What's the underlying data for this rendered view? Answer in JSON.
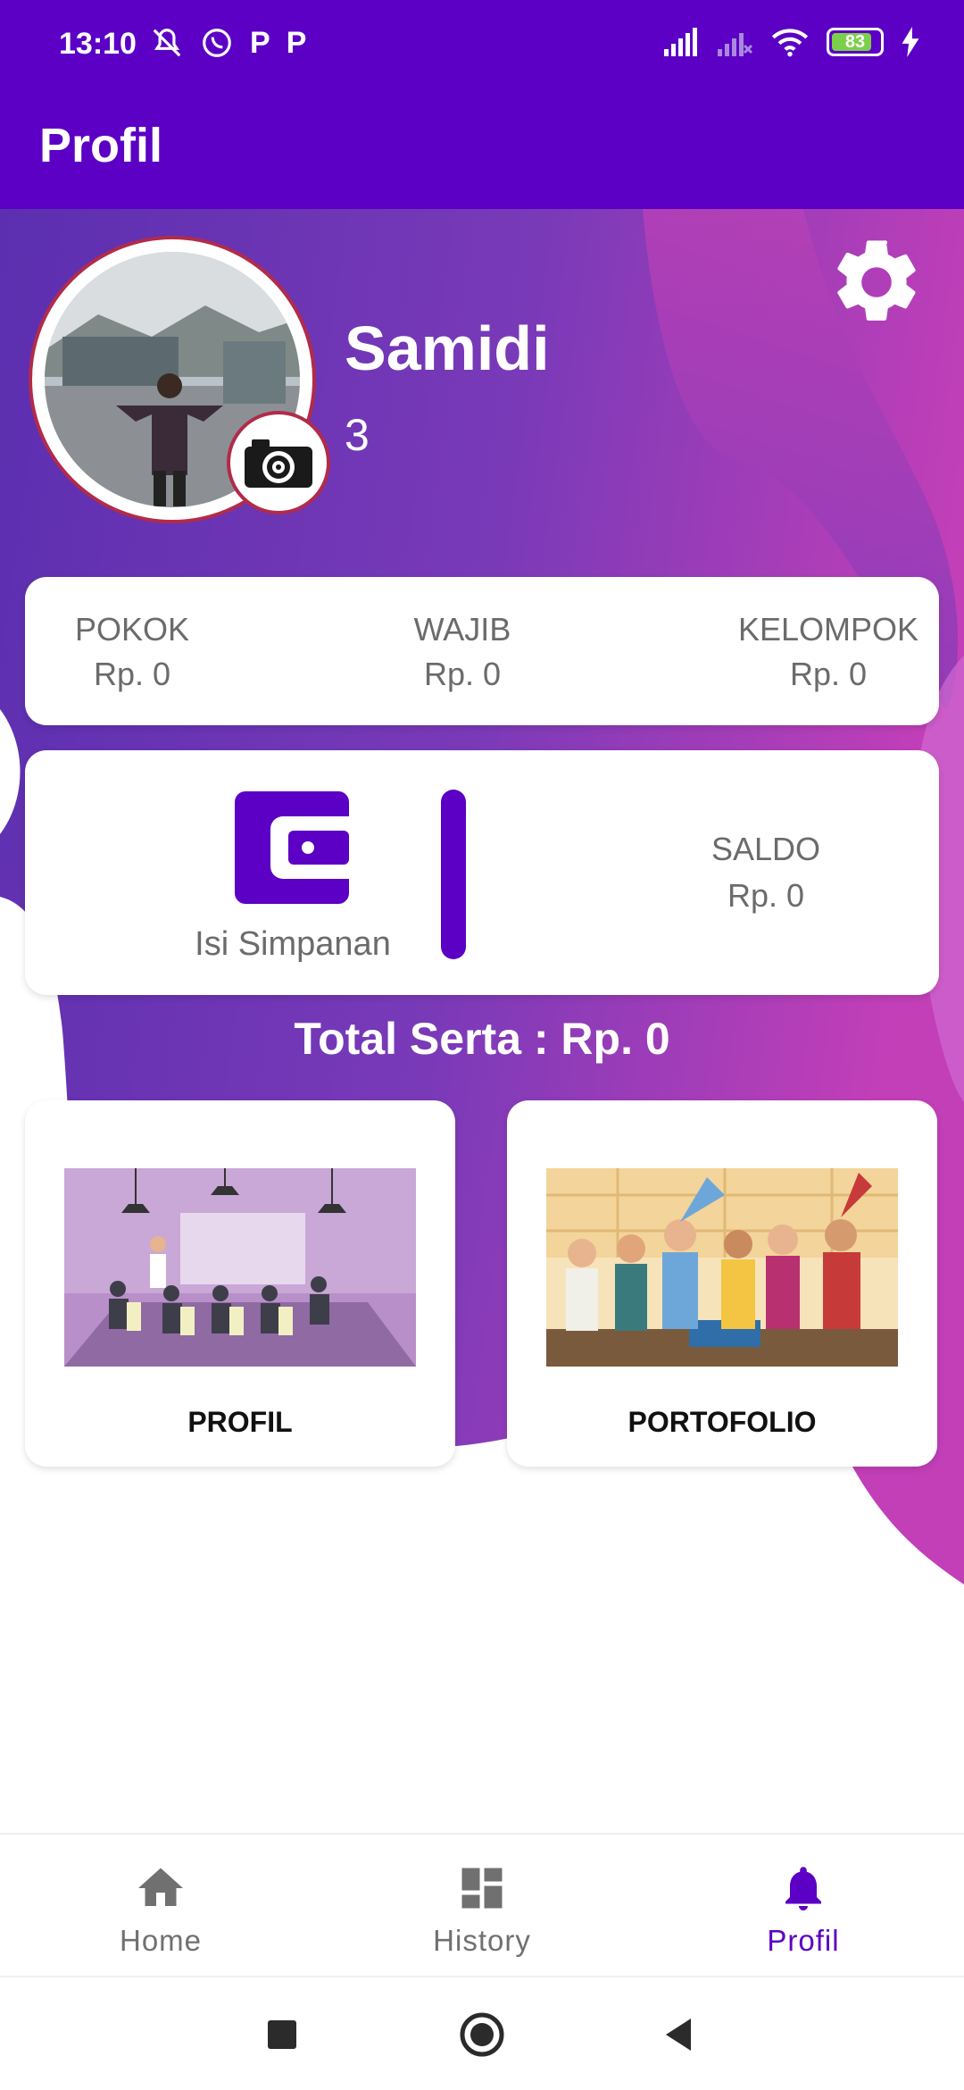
{
  "status_bar": {
    "time": "13:10",
    "left_glyphs": [
      "P",
      "P"
    ],
    "battery": "83",
    "icons": [
      "mute-icon",
      "whatsapp-icon",
      "p-app-icon",
      "p-app-icon",
      "signal-icon",
      "signal-off-icon",
      "wifi-icon",
      "battery-icon",
      "charging-icon"
    ]
  },
  "app_bar": {
    "title": "Profil"
  },
  "profile": {
    "name": "Samidi",
    "number": "3"
  },
  "savings": [
    {
      "label": "POKOK",
      "value": "Rp. 0"
    },
    {
      "label": "WAJIB",
      "value": "Rp. 0"
    },
    {
      "label": "KELOMPOK",
      "value": "Rp. 0"
    }
  ],
  "balance": {
    "action_label": "Isi Simpanan",
    "saldo_label": "SALDO",
    "saldo_value": "Rp. 0"
  },
  "total": "Total Serta : Rp. 0",
  "menu": [
    {
      "label": "PROFIL"
    },
    {
      "label": "PORTOFOLIO"
    }
  ],
  "bottom_nav": [
    {
      "label": "Home",
      "icon": "home-icon"
    },
    {
      "label": "History",
      "icon": "dashboard-icon"
    },
    {
      "label": "Profil",
      "icon": "bell-icon"
    }
  ],
  "colors": {
    "primary": "#5b00c4",
    "accent_pink": "#c23fb8",
    "text_gray": "#6b6b6b"
  }
}
